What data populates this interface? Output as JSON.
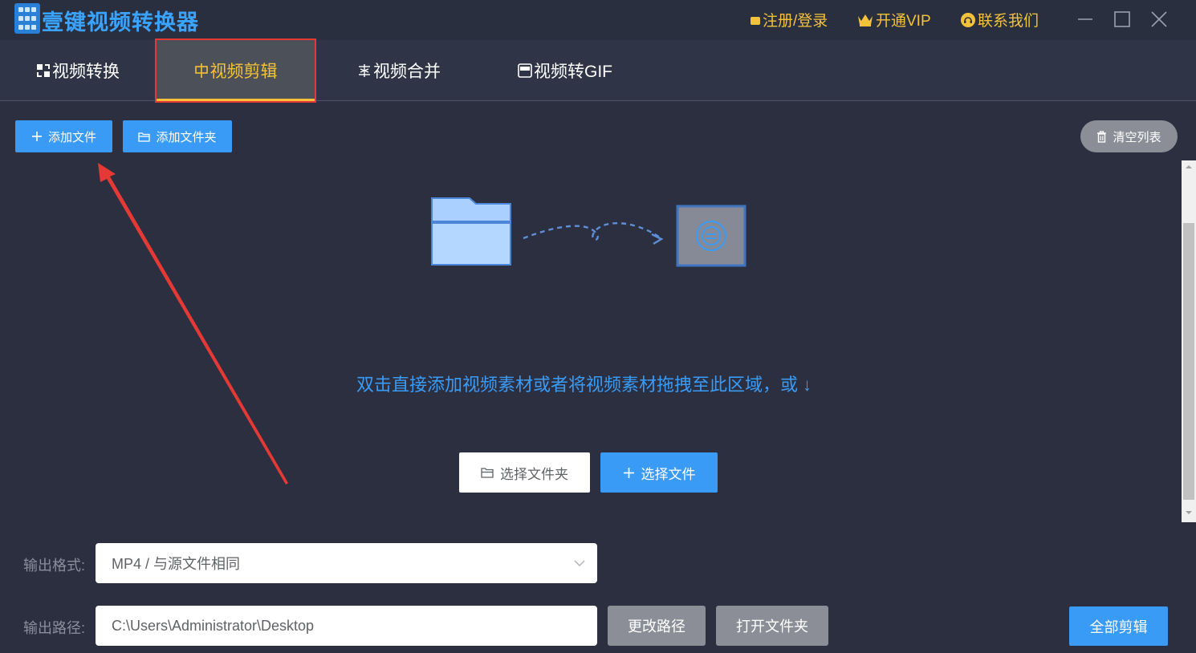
{
  "app": {
    "title": "壹键视频转换器"
  },
  "header": {
    "register_login": "注册/登录",
    "vip": "开通VIP",
    "contact": "联系我们"
  },
  "tabs": [
    {
      "label": "视频转换",
      "active": false
    },
    {
      "label": "视频剪辑",
      "active": true
    },
    {
      "label": "视频合并",
      "active": false
    },
    {
      "label": "视频转GIF",
      "active": false
    }
  ],
  "toolbar": {
    "add_file": "添加文件",
    "add_folder": "添加文件夹",
    "clear_list": "清空列表"
  },
  "dropzone": {
    "hint": "双击直接添加视频素材或者将视频素材拖拽至此区域，或 ↓",
    "select_folder": "选择文件夹",
    "select_file": "选择文件"
  },
  "output": {
    "format_label": "输出格式:",
    "format_value": "MP4 / 与源文件相同",
    "path_label": "输出路径:",
    "path_value": "C:\\Users\\Administrator\\Desktop",
    "change_path": "更改路径",
    "open_folder": "打开文件夹",
    "cut_all": "全部剪辑"
  },
  "colors": {
    "accent_blue": "#3a9bf7",
    "gold": "#f4c23a",
    "annotation_red": "#e53935",
    "background": "#2b2f40"
  }
}
